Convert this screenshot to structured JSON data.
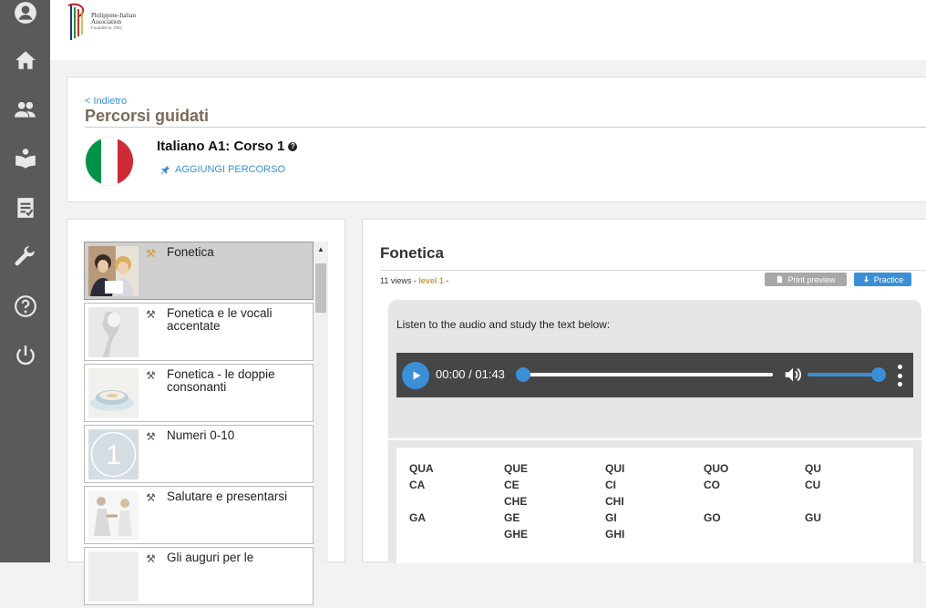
{
  "logo": {
    "line1": "Philippine-Italian",
    "line2": "Association",
    "line3": "Founded in 1962"
  },
  "header": {
    "back_label": "< Indietro",
    "page_title": "Percorsi guidati",
    "course_title": "Italiano A1: Corso 1",
    "help_glyph": "?",
    "add_path_label": "AGGIUNGI PERCORSO"
  },
  "sidebar": {
    "icons": [
      "user-icon",
      "home-icon",
      "group-icon",
      "book-reader-icon",
      "checklist-icon",
      "wrench-icon",
      "help-icon",
      "power-icon"
    ]
  },
  "lessons": [
    {
      "label": "Fonetica",
      "icon": "⚒",
      "active": true
    },
    {
      "label": "Fonetica e le vocali accentate",
      "icon": "⚒"
    },
    {
      "label": "Fonetica - le doppie consonanti",
      "icon": "⚒"
    },
    {
      "label": "Numeri 0-10",
      "icon": "⚒"
    },
    {
      "label": "Salutare e presentarsi",
      "icon": "⚒"
    },
    {
      "label": "Gli auguri per le",
      "icon": "⚒"
    }
  ],
  "thumb_number": "1",
  "lesson_detail": {
    "title": "Fonetica",
    "views": "11 views - ",
    "level": "level 1",
    "level_suffix": " -",
    "print_label": "Print preview",
    "practice_label": "Practice",
    "instruction": "Listen to the audio and study the text below:",
    "player": {
      "time": "00:00 / 01:43",
      "progress": 0,
      "volume": 1
    }
  },
  "syllables": [
    [
      "QUA",
      "QUE",
      "QUI",
      "QUO",
      "QU"
    ],
    [
      "CA",
      "CE",
      "CI",
      "CO",
      "CU"
    ],
    [
      "",
      "CHE",
      "CHI",
      "",
      ""
    ],
    [
      "GA",
      "GE",
      "GI",
      "GO",
      "GU"
    ],
    [
      "",
      "GHE",
      "GHI",
      "",
      ""
    ]
  ],
  "colors": {
    "sidebar": "#5a5a5a",
    "accent": "#3a8fd6",
    "title_brown": "#7a6a5a",
    "level_gold": "#c89a3c",
    "flag_green": "#009246",
    "flag_white": "#ffffff",
    "flag_red": "#ce2b37"
  }
}
